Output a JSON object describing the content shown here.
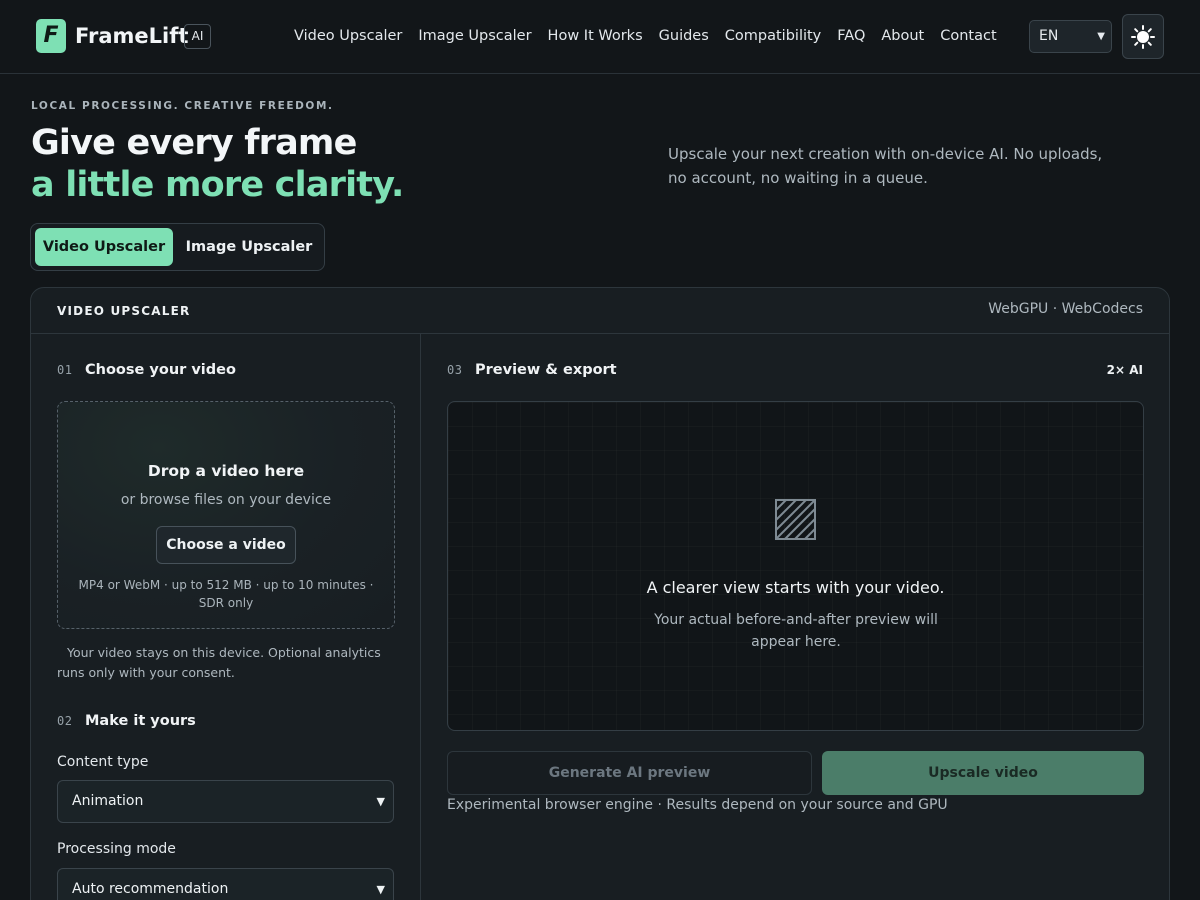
{
  "header": {
    "logo_letter": "F",
    "brand_name": "FrameLift",
    "brand_badge": "AI",
    "nav": [
      "Video Upscaler",
      "Image Upscaler",
      "How It Works",
      "Guides",
      "Compatibility",
      "FAQ",
      "About",
      "Contact"
    ],
    "language": "EN",
    "theme_icon": "sun-icon"
  },
  "hero": {
    "eyebrow": "LOCAL PROCESSING. CREATIVE FREEDOM.",
    "title_line1": "Give every frame",
    "title_line2": "a little more clarity.",
    "description": "Upscale your next creation with on-device AI. No uploads, no account, no waiting in a queue.",
    "tabs": [
      "Video Upscaler",
      "Image Upscaler"
    ],
    "active_tab": "Video Upscaler"
  },
  "panel": {
    "title": "VIDEO UPSCALER",
    "tech": "WebGPU · WebCodecs",
    "step1": {
      "number": "01",
      "title": "Choose your video",
      "drop_title": "Drop a video here",
      "drop_sub": "or browse files on your device",
      "button": "Choose a video",
      "limits": "MP4 or WebM · up to 512 MB · up to 10 minutes · SDR only",
      "privacy": "Your video stays on this device. Optional analytics runs only with your consent."
    },
    "step2": {
      "number": "02",
      "title": "Make it yours",
      "content_type_label": "Content type",
      "content_type_value": "Animation",
      "processing_mode_label": "Processing mode",
      "processing_mode_value": "Auto recommendation"
    },
    "step3": {
      "number": "03",
      "title": "Preview & export",
      "badge": "2× AI",
      "preview_title": "A clearer view starts with your video.",
      "preview_sub": "Your actual before-and-after preview will appear here.",
      "generate_button": "Generate AI preview",
      "upscale_button": "Upscale video",
      "engine_note": "Experimental browser engine · Results depend on your source and GPU"
    }
  },
  "colors": {
    "accent": "#7ee0b4",
    "background": "#121619",
    "panel": "#181e22",
    "upscale_button": "#4b7d69"
  }
}
